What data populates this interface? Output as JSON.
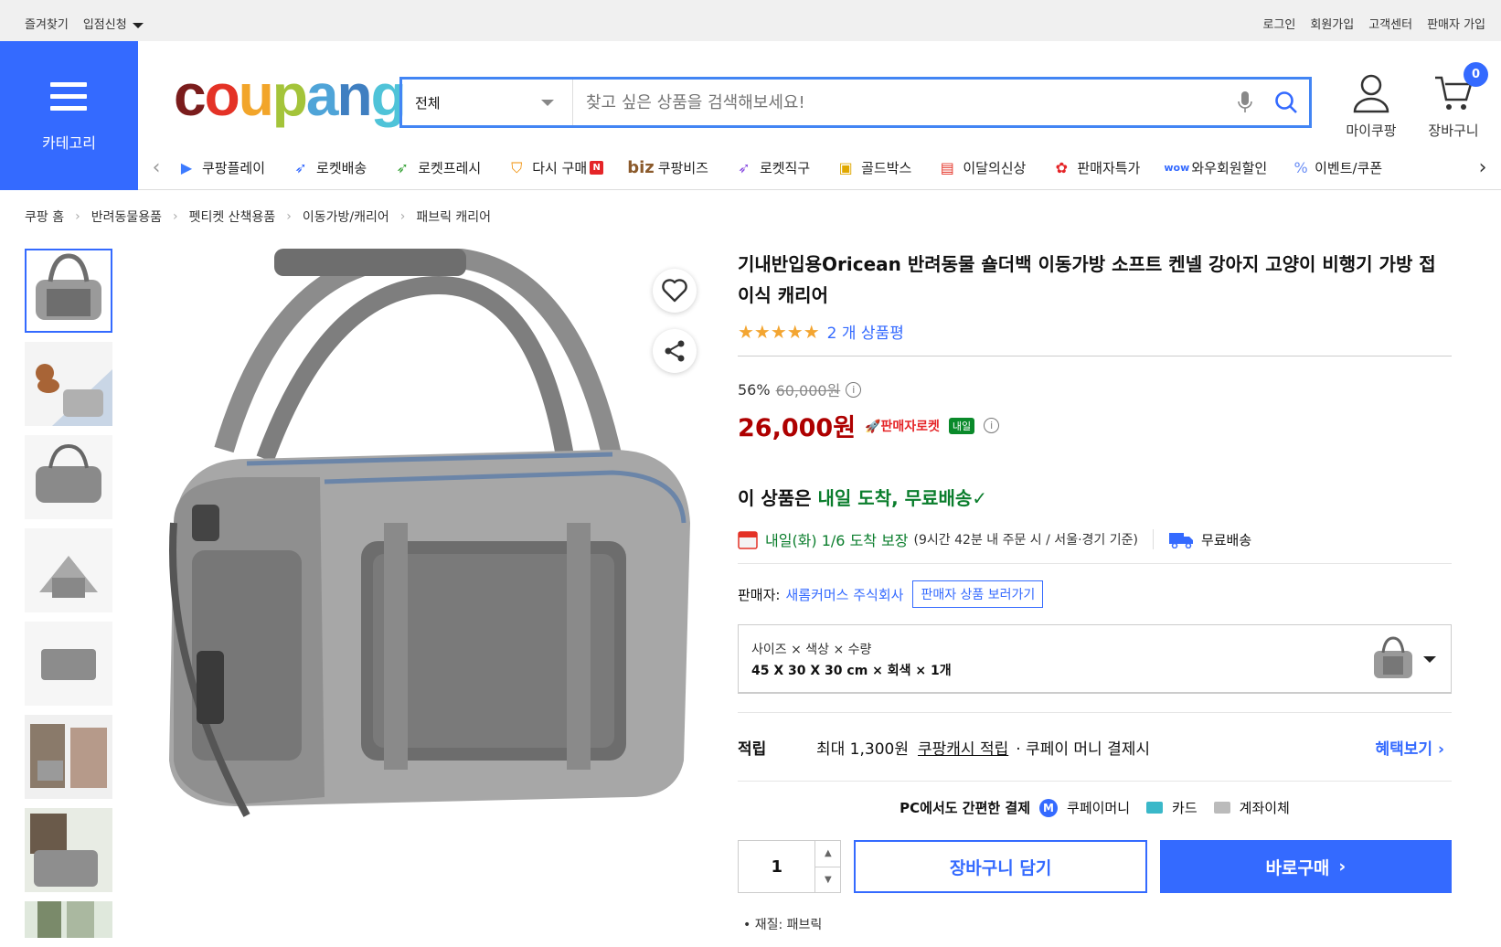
{
  "topbar": {
    "bookmark": "즐겨찾기",
    "apply": "입점신청",
    "login": "로그인",
    "signup": "회원가입",
    "support": "고객센터",
    "seller_signup": "판매자 가입"
  },
  "category_btn": {
    "label": "카테고리"
  },
  "logo": {
    "text": "coupang"
  },
  "search": {
    "category": "전체",
    "placeholder": "찾고 싶은 상품을 검색해보세요!"
  },
  "header": {
    "mycoupang": "마이쿠팡",
    "cart": "장바구니",
    "cart_count": "0"
  },
  "nav": [
    {
      "label": "쿠팡플레이",
      "icon": "play-icon"
    },
    {
      "label": "로켓배송",
      "icon": "rocket-icon"
    },
    {
      "label": "로켓프레시",
      "icon": "rocket-fresh-icon"
    },
    {
      "label": "다시 구매",
      "icon": "basket-icon"
    },
    {
      "label": "쿠팡비즈",
      "icon": "biz-icon"
    },
    {
      "label": "로켓직구",
      "icon": "rocket-global-icon"
    },
    {
      "label": "골드박스",
      "icon": "goldbox-icon"
    },
    {
      "label": "이달의신상",
      "icon": "new-icon"
    },
    {
      "label": "판매자특가",
      "icon": "percent-icon"
    },
    {
      "label": "와우회원할인",
      "icon": "wow-icon"
    },
    {
      "label": "이벤트/쿠폰",
      "icon": "coupon-icon"
    }
  ],
  "breadcrumb": [
    "쿠팡 홈",
    "반려동물용품",
    "펫티켓 산책용품",
    "이동가방/캐리어",
    "패브릭 캐리어"
  ],
  "product": {
    "title": "기내반입용Oricean 반려동물 숄더백 이동가방 소프트 켄넬 강아지 고양이 비행기 가방 접이식 캐리어",
    "rating_count": "2 개 상품평",
    "discount": "56%",
    "original_price": "60,000원",
    "price": "26,000원",
    "seller_rocket": "판매자로켓",
    "tomorrow": "내일",
    "delivery_prefix": "이 상품은 ",
    "delivery_highlight": "내일 도착, 무료배송",
    "eta_date": "내일(화) 1/6 도착 보장",
    "eta_note": "(9시간 42분 내 주문 시 / 서울·경기 기준)",
    "free_shipping": "무료배송",
    "seller_label": "판매자:",
    "seller_name": "새롬커머스 주식회사",
    "seller_products": "판매자 상품 보러가기",
    "option_label": "사이즈 × 색상 × 수량",
    "option_value": "45 X 30 X 30 cm × 회색 × 1개",
    "cash_label": "적립",
    "cash_prefix": "최대 1,300원",
    "cash_link": "쿠팡캐시 적립",
    "cash_suffix": "· 쿠페이 머니 결제시",
    "cash_more": "혜택보기",
    "pay_title": "PC에서도 간편한 결제",
    "pay_money": "쿠페이머니",
    "pay_card": "카드",
    "pay_bank": "계좌이체",
    "quantity": "1",
    "add_cart": "장바구니 담기",
    "buy_now": "바로구매",
    "material": "재질: 패브릭"
  },
  "colors": {
    "accent": "#346aff",
    "price": "#ae0000",
    "green": "#0a7d2c",
    "star": "#f3a531"
  }
}
